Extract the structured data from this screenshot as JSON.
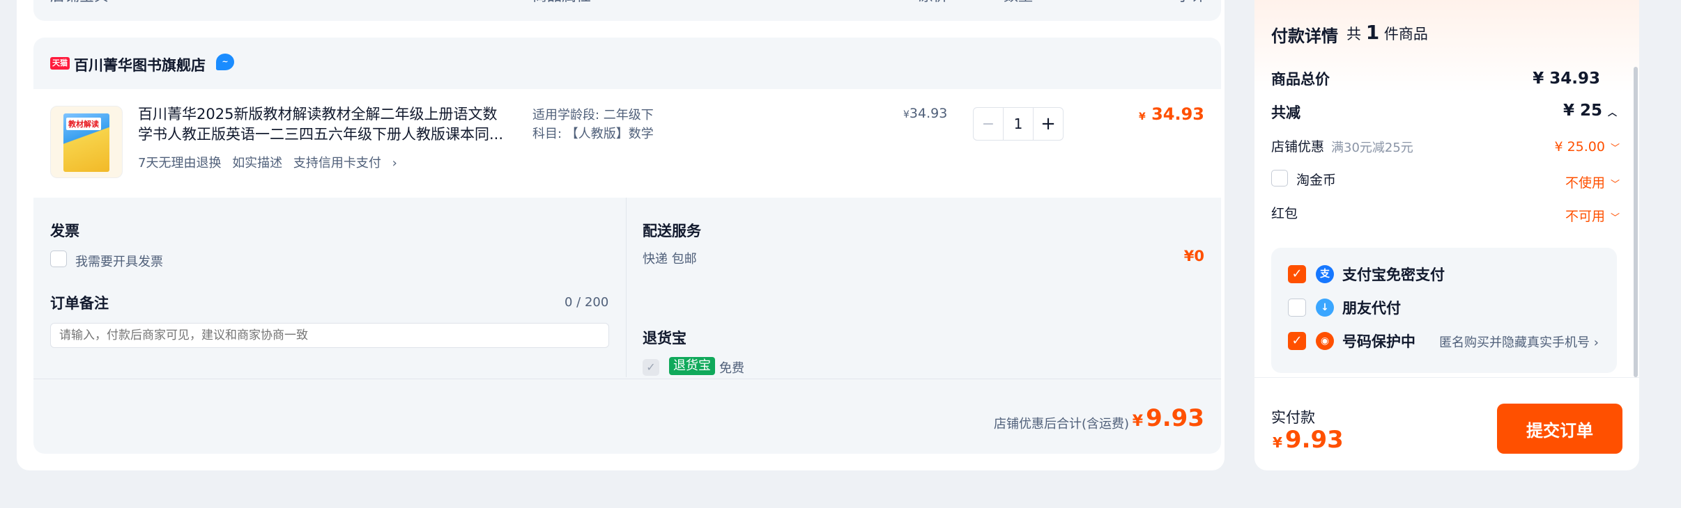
{
  "header_strip": {
    "col_store": "店铺宝贝",
    "col_attrs": "商品属性",
    "col_price": "原价",
    "col_qty": "数量",
    "col_subtotal": "小计"
  },
  "store": {
    "badge": "天猫",
    "name": "百川菁华图书旗舰店",
    "chat_icon": "wangwang-chat-icon"
  },
  "item": {
    "thumb_title": "教材解读",
    "title_line1": "百川菁华2025新版教材解读教材全解二年级上册语文数",
    "title_line2": "学书人教正版英语一二三四五六年级下册人教版课本同...",
    "tags": [
      "7天无理由退换",
      "如实描述",
      "支持信用卡支付"
    ],
    "attr1": "适用学龄段: 二年级下",
    "attr2": "科目: 【人教版】数学",
    "unit_price": "34.93",
    "quantity": "1",
    "total_price": "34.93",
    "currency": "¥"
  },
  "invoice": {
    "title": "发票",
    "checkbox_label": "我需要开具发票"
  },
  "remark": {
    "title": "订单备注",
    "counter": "0 / 200",
    "placeholder": "请输入，付款后商家可见，建议和商家协商一致"
  },
  "shipping": {
    "title": "配送服务",
    "method": "快递 包邮",
    "price": "¥0"
  },
  "returns": {
    "title": "退货宝",
    "badge": "退货宝",
    "fee": "免费"
  },
  "summary": {
    "label": "店铺优惠后合计(含运费)",
    "currency": "¥",
    "amount": "9.93"
  },
  "payment": {
    "title": "付款详情",
    "count_prefix": "共",
    "count": "1",
    "count_suffix": "件商品",
    "goods_total_label": "商品总价",
    "goods_total": "¥ 34.93",
    "discount_label": "共减",
    "discount_total": "¥ 25",
    "store_coupon_label": "店铺优惠",
    "store_coupon_rule": "满30元减25元",
    "store_coupon_value": "¥ 25.00",
    "taojinbi_label": "淘金币",
    "taojinbi_value": "不使用",
    "redpacket_label": "红包",
    "redpacket_value": "不可用",
    "options": [
      {
        "label": "支付宝免密支付",
        "checked": true
      },
      {
        "label": "朋友代付",
        "checked": false
      },
      {
        "label": "号码保护中",
        "checked": true,
        "note": "匿名购买并隐藏真实手机号"
      }
    ],
    "actual_label": "实付款",
    "actual_currency": "¥",
    "actual_amount": "9.93",
    "submit_label": "提交订单"
  },
  "colors": {
    "accent": "#ff5000",
    "tmall_red": "#ff1a3c",
    "returns_green": "#10a95b"
  }
}
